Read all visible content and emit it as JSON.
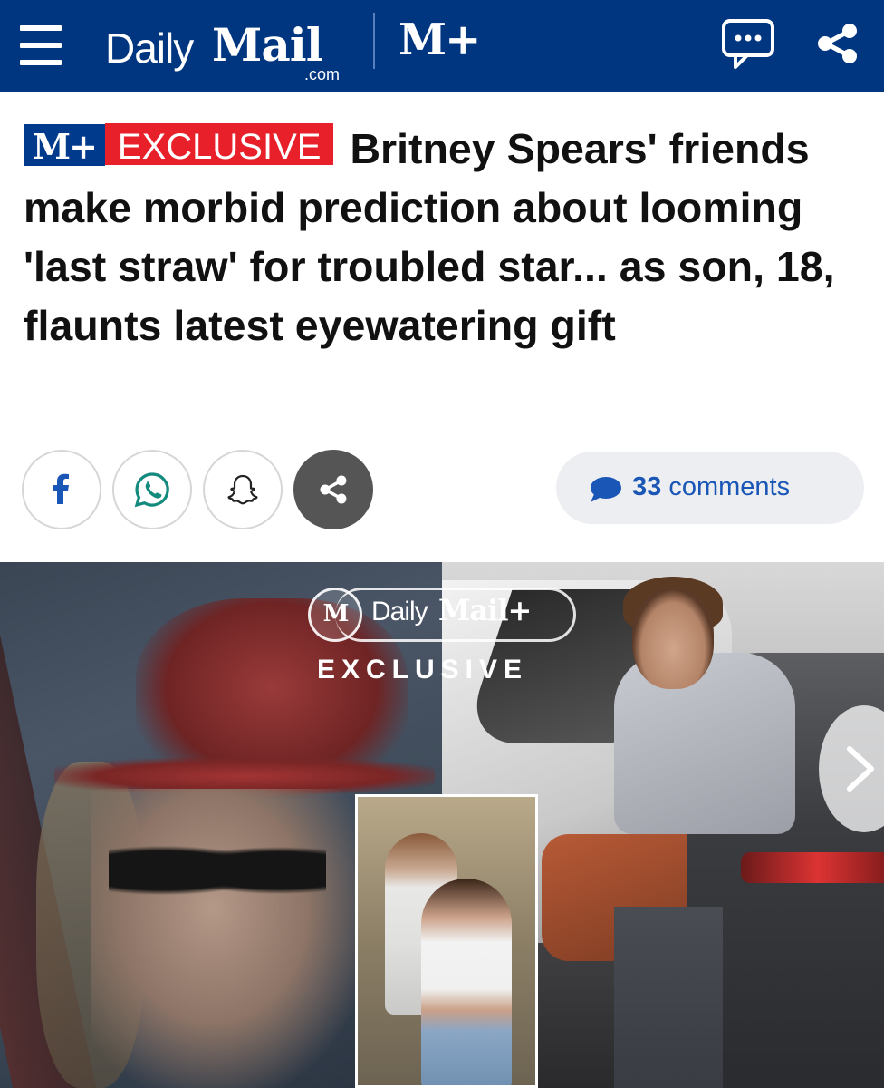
{
  "header": {
    "logo_daily": "Daily",
    "logo_mail": "Mail",
    "logo_com": ".com",
    "mplus_label": "M+",
    "brand_color": "#003580"
  },
  "article": {
    "badge_mplus": "M+",
    "badge_exclusive": "EXCLUSIVE",
    "headline": "Britney Spears' friends make morbid prediction about looming 'last straw' for troubled star... as son, 18, flaunts latest eyewatering gift"
  },
  "share": {
    "buttons": [
      "facebook-icon",
      "whatsapp-icon",
      "snapchat-icon",
      "share-icon"
    ],
    "comments_count": "33",
    "comments_label": "comments"
  },
  "image": {
    "watermark_daily": "Daily",
    "watermark_mail": "Mail+",
    "watermark_m": "M",
    "watermark_exclusive": "EXCLUSIVE"
  },
  "colors": {
    "accent_red": "#e8202a",
    "link_blue": "#1a56b6"
  }
}
